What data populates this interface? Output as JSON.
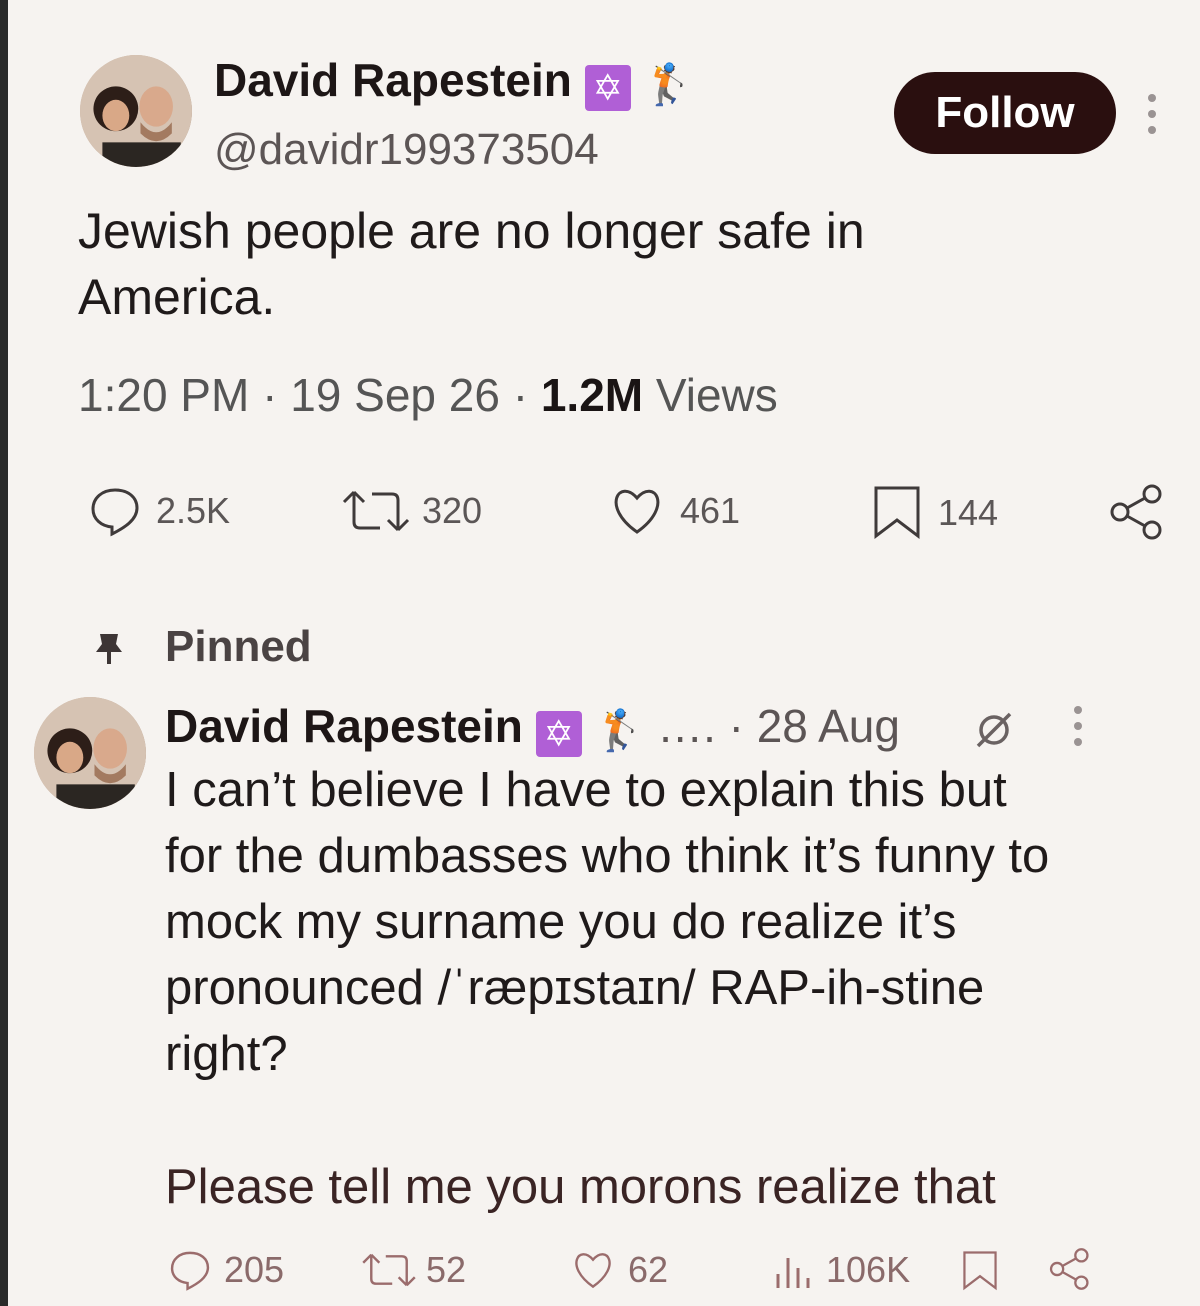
{
  "main_tweet": {
    "author_name": "David Rapestein",
    "badge_symbol": "✡",
    "emoji": "🏌",
    "handle": "@davidr199373504",
    "follow_label": "Follow",
    "text": "Jewish people are no longer safe in America.",
    "time": "1:20 PM",
    "sep": "·",
    "date": "19 Sep 26",
    "views_count": "1.2M",
    "views_label": "Views",
    "actions": {
      "replies": "2.5K",
      "retweets": "320",
      "likes": "461",
      "bookmarks": "144"
    }
  },
  "pinned_label": "Pinned",
  "pinned_tweet": {
    "author_name": "David Rapestein",
    "badge_symbol": "✡",
    "emoji": "🏌",
    "meta": "…. · 28 Aug",
    "text_lines": [
      "I can’t believe I have to explain this but",
      "for the dumbasses who think it’s funny to",
      "mock my surname you do realize it’s",
      "pronounced /ˈræpɪstaɪn/ RAP-ih-stine",
      "right?"
    ],
    "text_more": "Please tell me you morons realize that",
    "actions": {
      "replies": "205",
      "retweets": "52",
      "likes": "62",
      "views": "106K"
    }
  },
  "colors": {
    "follow_bg": "#2a0f0f",
    "badge_bg": "#b05fd6"
  },
  "icons": [
    "reply-icon",
    "retweet-icon",
    "like-icon",
    "bookmark-icon",
    "share-icon",
    "pin-icon",
    "views-icon",
    "grok-icon",
    "more-icon"
  ]
}
